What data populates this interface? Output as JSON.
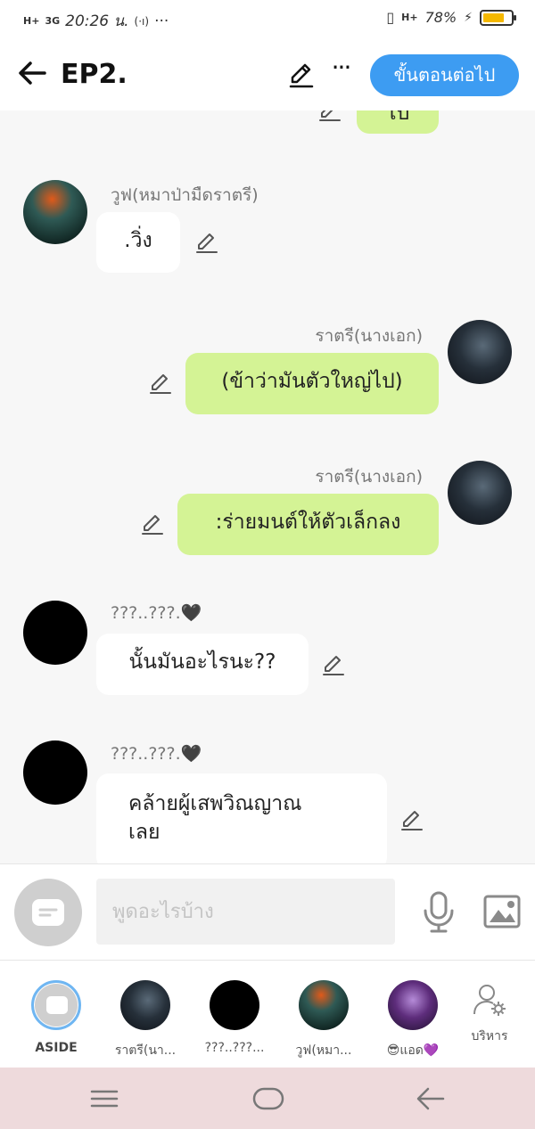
{
  "status_bar": {
    "network_left": "H+",
    "network_right": "3G",
    "time": "20:26 น.",
    "cast": "(·ı)",
    "dots": "···",
    "vibrate": "▯",
    "network_data": "H+",
    "battery_percent": "78%",
    "battery_level": 0.78
  },
  "header": {
    "title": "EP2.",
    "more": "···",
    "next_label": "ขั้นตอนต่อไป"
  },
  "messages": [
    {
      "sender": "",
      "text": "ไป",
      "side": "out"
    },
    {
      "sender": "วูฟ(หมาป่ามืดราตรี)",
      "text": ".วิ่ง",
      "side": "in"
    },
    {
      "sender": "ราตรี(นางเอก)",
      "text": "(ข้าว่ามันตัวใหญ่ไป)",
      "side": "out"
    },
    {
      "sender": "ราตรี(นางเอก)",
      "text": ":ร่ายมนต์ให้ตัวเล็กลง",
      "side": "out"
    },
    {
      "sender": "???..???.🖤",
      "text": "นั้นมันอะไรนะ??",
      "side": "in"
    },
    {
      "sender": "???..???.🖤",
      "text": "คล้ายผู้เสพวิณญาณ\nเลย",
      "side": "in"
    }
  ],
  "composer": {
    "placeholder": "พูดอะไรบ้าง"
  },
  "characters": [
    {
      "label": "ASIDE"
    },
    {
      "label": "ราตรี(นา..."
    },
    {
      "label": "???..???..."
    },
    {
      "label": "วูฟ(หมา..."
    },
    {
      "label": "😎แอด💜"
    },
    {
      "label": "บริหาร"
    }
  ]
}
